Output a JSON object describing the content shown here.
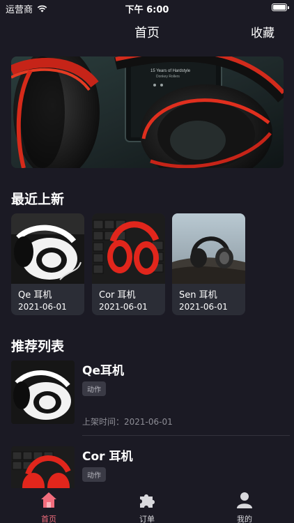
{
  "status_bar": {
    "carrier": "运营商",
    "time": "下午 6:00"
  },
  "nav": {
    "title": "首页",
    "favorites": "收藏"
  },
  "banner": {
    "label": "",
    "screen_title": "15 Years of Hardstyle",
    "screen_subtitle": "Donkey Rollers"
  },
  "sections": {
    "new_arrivals": "最近上新",
    "recommend": "推荐列表"
  },
  "new_arrivals": [
    {
      "name": "Qe 耳机",
      "date": "2021-06-01"
    },
    {
      "name": "Cor 耳机",
      "date": "2021-06-01"
    },
    {
      "name": "Sen 耳机",
      "date": "2021-06-01"
    }
  ],
  "recommend": [
    {
      "name": "Qe耳机",
      "tag": "动作",
      "date_label": "上架时间：2021-06-01"
    },
    {
      "name": "Cor 耳机",
      "tag": "动作",
      "date_label": ""
    }
  ],
  "tabs": [
    {
      "label": "首页",
      "icon": "home-icon",
      "active": true
    },
    {
      "label": "订单",
      "icon": "puzzle-icon",
      "active": false
    },
    {
      "label": "我的",
      "icon": "user-icon",
      "active": false
    }
  ],
  "colors": {
    "background": "#1b1a24",
    "accent": "#f26d7d",
    "card": "#2b2d36"
  }
}
